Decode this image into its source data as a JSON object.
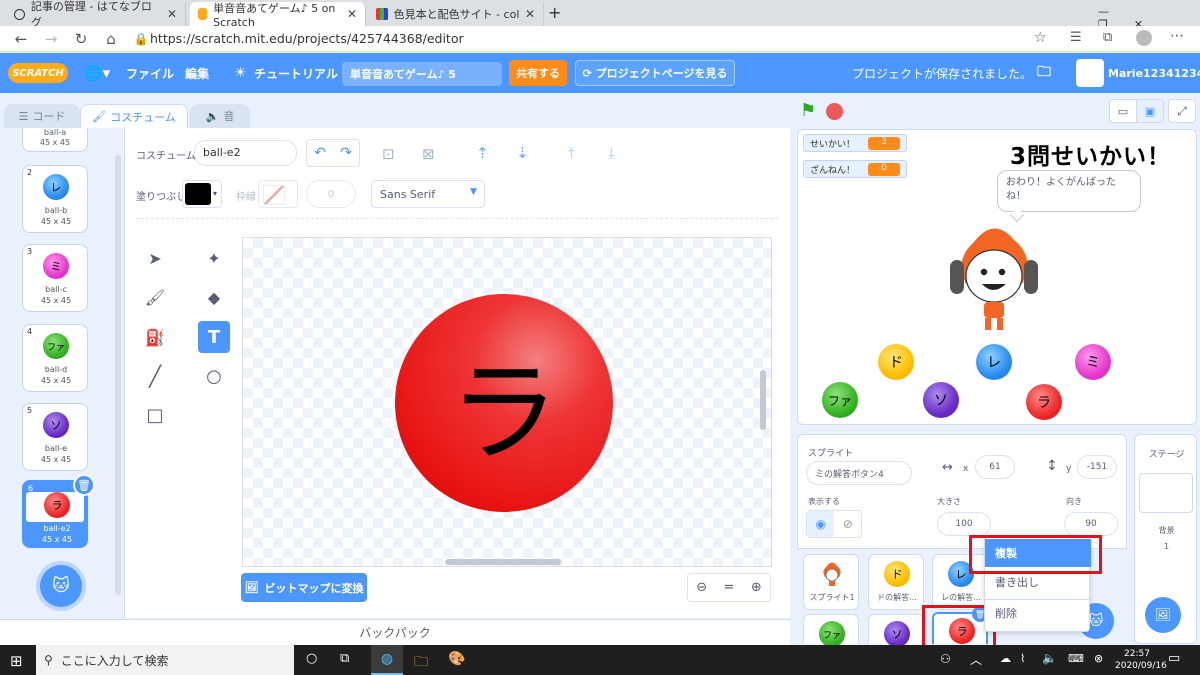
{
  "browser": {
    "tabs": [
      {
        "title": "記事の管理 - はてなブログ",
        "close": "✕"
      },
      {
        "title": "単音音あてゲーム♪ 5 on Scratch",
        "close": "✕"
      },
      {
        "title": "色見本と配色サイト - color-sampl",
        "close": "✕"
      }
    ],
    "new_tab": "+",
    "url": "https://scratch.mit.edu/projects/425744368/editor"
  },
  "menubar": {
    "logo": "SCRATCH",
    "file": "ファイル",
    "edit": "編集",
    "tutorial": "チュートリアル",
    "project_title": "単音音あてゲーム♪ 5",
    "share": "共有する",
    "project_page": "プロジェクトページを見る",
    "saved_status": "プロジェクトが保存されました。",
    "username": "Marie12341234"
  },
  "editor_tabs": {
    "code": "コード",
    "costume": "コスチューム",
    "sound": "音"
  },
  "costumes": [
    {
      "num": "",
      "label": "ball-a",
      "size": "45 x 45",
      "char": "",
      "color": "yellow"
    },
    {
      "num": "2",
      "label": "ball-b",
      "size": "45 x 45",
      "char": "レ",
      "color": "blue"
    },
    {
      "num": "3",
      "label": "ball-c",
      "size": "45 x 45",
      "char": "ミ",
      "color": "pink"
    },
    {
      "num": "4",
      "label": "ball-d",
      "size": "45 x 45",
      "char": "ファ",
      "color": "green"
    },
    {
      "num": "5",
      "label": "ball-e",
      "size": "45 x 45",
      "char": "ソ",
      "color": "purple"
    },
    {
      "num": "6",
      "label": "ball-e2",
      "size": "45 x 45",
      "char": "ラ",
      "color": "red"
    }
  ],
  "paint": {
    "costume_label": "コスチューム",
    "costume_name": "ball-e2",
    "fill_label": "塗りつぶし",
    "outline_label": "枠線",
    "outline_width": "0",
    "font": "Sans Serif",
    "canvas_char": "ラ",
    "bitmap_button": "ビットマップに変換",
    "zoom_reset": "="
  },
  "backpack": "バックパック",
  "stage": {
    "vars": [
      {
        "name": "せいかい！",
        "value": "3"
      },
      {
        "name": "ざんねん！",
        "value": "0"
      }
    ],
    "headline": "3問せいかい！",
    "speech": "おわり！よくがんばったね！",
    "balls": [
      {
        "char": "ド",
        "color": "yellow"
      },
      {
        "char": "レ",
        "color": "blue"
      },
      {
        "char": "ミ",
        "color": "pink"
      },
      {
        "char": "ファ",
        "color": "green"
      },
      {
        "char": "ソ",
        "color": "purple"
      },
      {
        "char": "ラ",
        "color": "red"
      }
    ]
  },
  "sprite_info": {
    "sprite_label": "スプライト",
    "sprite_name": "ミの解答ボタン4",
    "x_label": "x",
    "x": "61",
    "y_label": "y",
    "y": "-151",
    "show_label": "表示する",
    "size_label": "大きさ",
    "size": "100",
    "direction_label": "向き",
    "direction": "90"
  },
  "sprites": [
    {
      "name": "スプライト1",
      "char": "",
      "color": "orange"
    },
    {
      "name": "ドの解答...",
      "char": "ド",
      "color": "yellow"
    },
    {
      "name": "レの解答...",
      "char": "レ",
      "color": "blue"
    },
    {
      "name": "",
      "char": "ファ",
      "color": "green"
    },
    {
      "name": "",
      "char": "ソ",
      "color": "purple"
    },
    {
      "name": "",
      "char": "ラ",
      "color": "red"
    }
  ],
  "context_menu": {
    "duplicate": "複製",
    "export": "書き出し",
    "delete": "削除"
  },
  "stage_panel": {
    "title": "ステージ",
    "backdrop_label": "背景",
    "backdrop_count": "1"
  },
  "taskbar": {
    "search": "ここに入力して検索",
    "time": "22:57",
    "date": "2020/09/16"
  },
  "colors": {
    "scratch_blue": "#4c97ff",
    "orange": "#ff8c1a",
    "highlight": "#e1121b"
  }
}
